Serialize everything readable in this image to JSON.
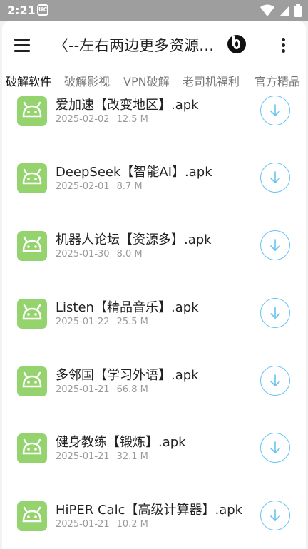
{
  "status_bar": {
    "time": "2:21",
    "app_icon_text": "UC"
  },
  "toolbar": {
    "title": "〈--左右两边更多资源-..."
  },
  "tabs": [
    {
      "label": "破解软件",
      "active": true
    },
    {
      "label": "破解影视",
      "active": false
    },
    {
      "label": "VPN破解",
      "active": false
    },
    {
      "label": "老司机福利",
      "active": false
    },
    {
      "label": "官方精品",
      "active": false
    }
  ],
  "files": [
    {
      "name": "爱加速【改变地区】.apk",
      "date": "2025-02-02",
      "size": "12.5 M"
    },
    {
      "name": "DeepSeek【智能AI】.apk",
      "date": "2025-02-01",
      "size": "8.7 M"
    },
    {
      "name": "机器人论坛【资源多】.apk",
      "date": "2025-01-30",
      "size": "8.0 M"
    },
    {
      "name": "Listen【精品音乐】.apk",
      "date": "2025-01-22",
      "size": "25.5 M"
    },
    {
      "name": "多邻国【学习外语】.apk",
      "date": "2025-01-21",
      "size": "66.8 M"
    },
    {
      "name": "健身教练【锻炼】.apk",
      "date": "2025-01-21",
      "size": "32.1 M"
    },
    {
      "name": "HiPER Calc【高级计算器】.apk",
      "date": "2025-01-21",
      "size": "10.2 M"
    }
  ],
  "colors": {
    "icon_green": "#95d36f",
    "download_blue": "#67c3f2",
    "status_bar": "#9e9e9e"
  },
  "icons": {
    "file_icon": "android-icon",
    "download": "download-icon"
  }
}
